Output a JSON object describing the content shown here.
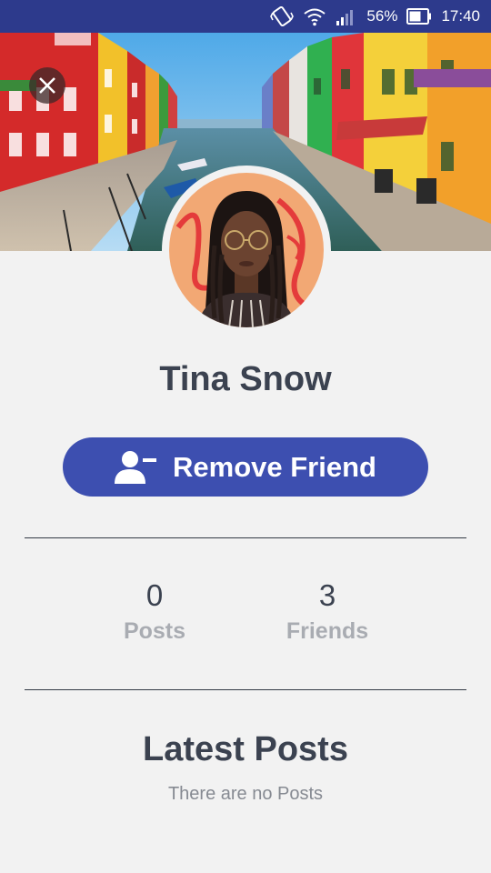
{
  "status_bar": {
    "battery_percent": "56%",
    "time": "17:40"
  },
  "profile": {
    "name": "Tina Snow",
    "action_button_label": "Remove Friend"
  },
  "stats": {
    "posts": {
      "count": "0",
      "label": "Posts"
    },
    "friends": {
      "count": "3",
      "label": "Friends"
    }
  },
  "latest_posts": {
    "title": "Latest Posts",
    "empty_message": "There are no Posts"
  },
  "colors": {
    "status_bar_bg": "#2d3a8c",
    "primary_button": "#3d4fb0",
    "page_bg": "#f2f2f2",
    "heading_text": "#3b4250",
    "muted_label": "#a9acb2"
  },
  "icons": {
    "close": "close-icon",
    "remove_friend": "user-minus-icon",
    "vibrate": "vibrate-icon",
    "wifi": "wifi-icon",
    "signal": "signal-icon",
    "battery": "battery-icon"
  }
}
